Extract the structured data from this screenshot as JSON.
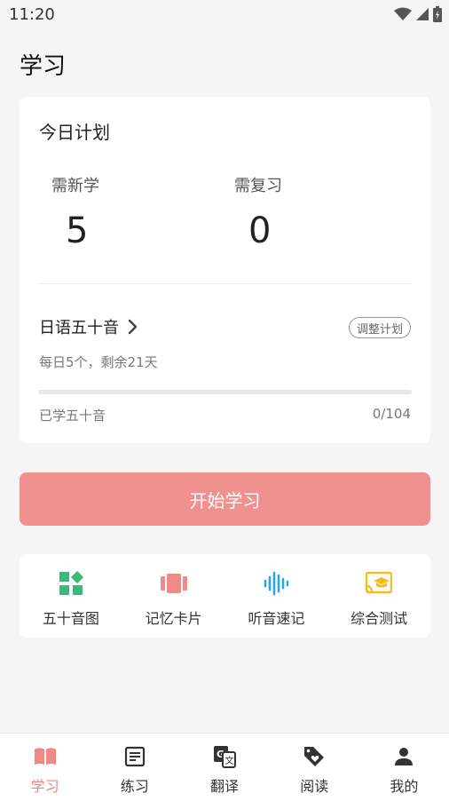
{
  "status": {
    "time": "11:20"
  },
  "page": {
    "title": "学习"
  },
  "plan": {
    "title": "今日计划",
    "new_label": "需新学",
    "new_value": "5",
    "review_label": "需复习",
    "review_value": "0"
  },
  "course": {
    "name": "日语五十音",
    "adjust_label": "调整计划",
    "subtitle": "每日5个，剩余21天",
    "progress_label": "已学五十音",
    "progress_text": "0/104",
    "progress_fraction": 0
  },
  "start_button": "开始学习",
  "tools": [
    {
      "label": "五十音图",
      "icon": "kana-chart-icon",
      "color": "#3cb87a"
    },
    {
      "label": "记忆卡片",
      "icon": "flashcard-icon",
      "color": "#ef8a86"
    },
    {
      "label": "听音速记",
      "icon": "audio-wave-icon",
      "color": "#2ba4e6"
    },
    {
      "label": "综合测试",
      "icon": "test-cast-icon",
      "color": "#f4bc1f"
    }
  ],
  "tabs": [
    {
      "label": "学习",
      "icon": "book-icon",
      "active": true
    },
    {
      "label": "练习",
      "icon": "practice-icon",
      "active": false
    },
    {
      "label": "翻译",
      "icon": "translate-icon",
      "active": false
    },
    {
      "label": "阅读",
      "icon": "tag-heart-icon",
      "active": false
    },
    {
      "label": "我的",
      "icon": "user-icon",
      "active": false
    }
  ],
  "colors": {
    "accent": "#ef8f8d",
    "background": "#f5f5f5"
  }
}
